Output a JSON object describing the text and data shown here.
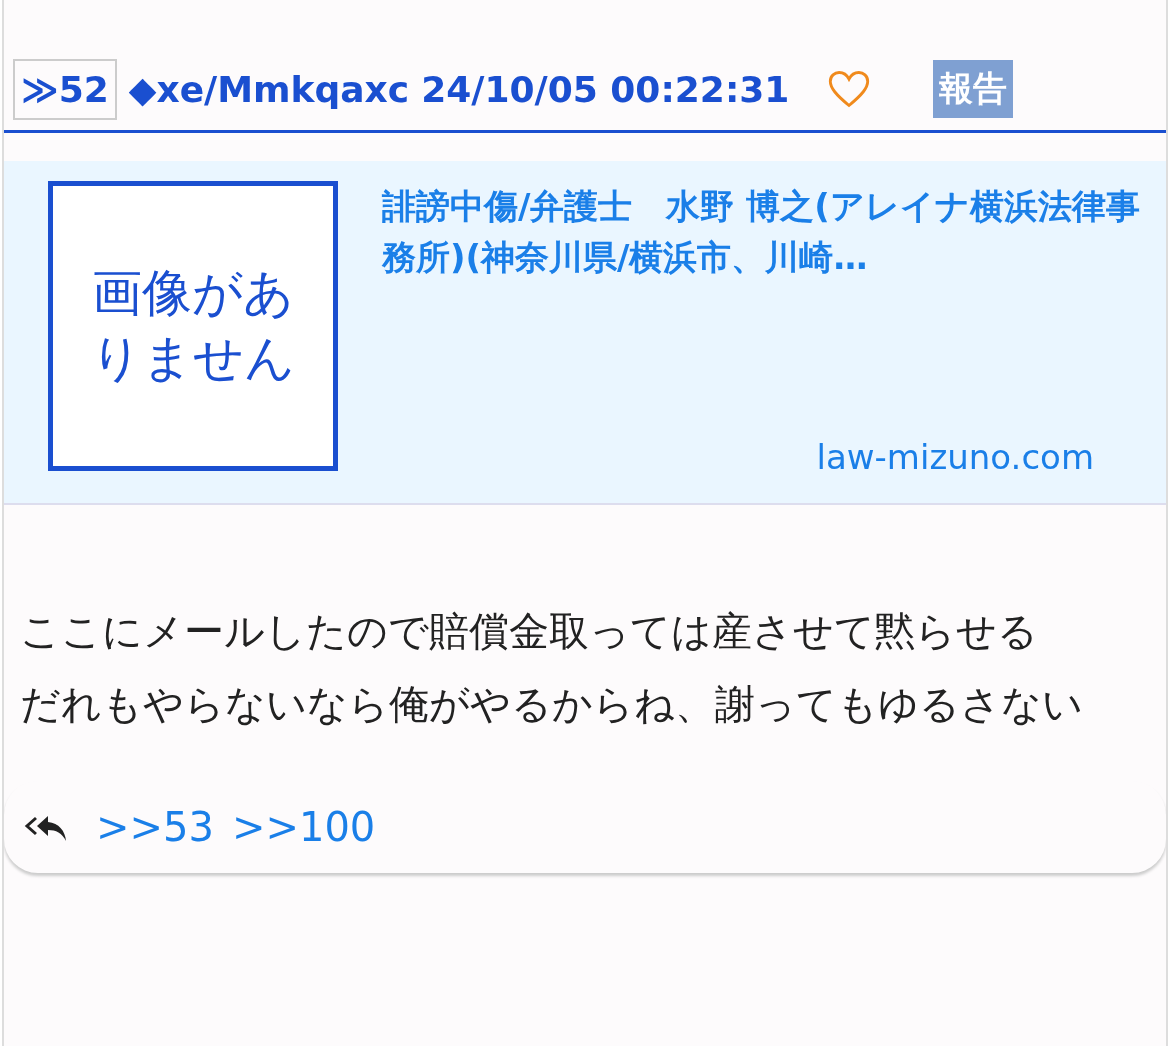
{
  "post": {
    "number": "≫52",
    "author": "◆xe/Mmkqaxc",
    "date": "24/10/05 00:22:31",
    "report": "報告"
  },
  "link_card": {
    "image_text": "画像がありません",
    "title": "誹謗中傷/弁護士　水野 博之(アレイナ横浜法律事務所)(神奈川県/横浜市、川崎…",
    "url": "law-mizuno.com"
  },
  "body": [
    "ここにメールしたので賠償金取っては産させて黙らせる",
    "だれもやらないなら俺がやるからね、謝ってもゆるさない"
  ],
  "replies": [
    ">>53",
    ">>100"
  ]
}
